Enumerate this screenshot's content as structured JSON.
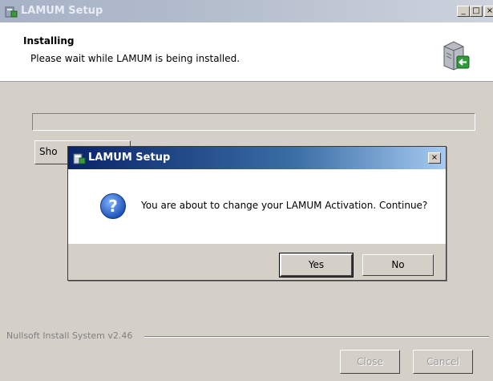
{
  "window": {
    "title": "LAMUM Setup",
    "minimize_glyph": "_",
    "maximize_glyph": "□",
    "close_glyph": "×",
    "app_icon": "installer-icon"
  },
  "header": {
    "title": "Installing",
    "subtitle": "Please wait while LAMUM is being installed.",
    "icon": "server-install-icon"
  },
  "progress": {
    "value": 0
  },
  "details_button": {
    "label": "Sho"
  },
  "footer": {
    "branding": "Nullsoft Install System v2.46",
    "close_label": "Close",
    "cancel_label": "Cancel"
  },
  "dialog": {
    "title": "LAMUM Setup",
    "close_glyph": "×",
    "icon": "question-icon",
    "message": "You are about to change your LAMUM Activation. Continue?",
    "yes_label": "Yes",
    "no_label": "No"
  },
  "colors": {
    "face": "#d4d0c8",
    "active_title_start": "#0a246a",
    "active_title_end": "#a6caf0",
    "inactive_title": "#a7b2c7",
    "question_blue": "#1f5fc8"
  }
}
